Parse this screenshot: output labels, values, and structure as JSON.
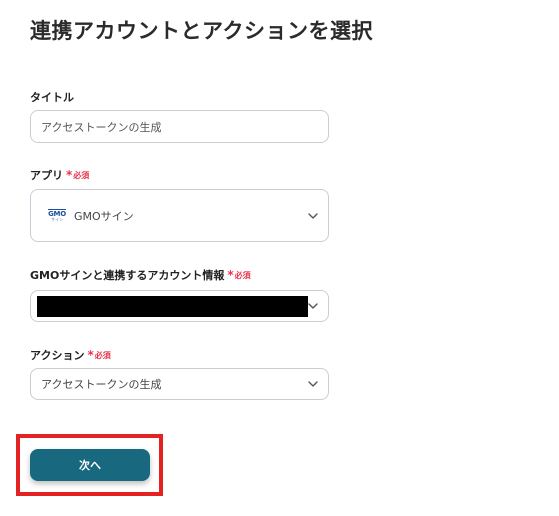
{
  "page": {
    "title": "連携アカウントとアクションを選択"
  },
  "form": {
    "title_field": {
      "label": "タイトル",
      "value": "アクセストークンの生成"
    },
    "app_field": {
      "label": "アプリ",
      "required_mark": "*",
      "required_text": "必須",
      "selected_app": "GMOサイン",
      "app_icon": "gmo-sign-logo",
      "logo_text": "GMO",
      "logo_sub": "サイン"
    },
    "account_field": {
      "label": "GMOサインと連携するアカウント情報",
      "required_mark": "*",
      "required_text": "必須",
      "selected_value": "[redacted]"
    },
    "action_field": {
      "label": "アクション",
      "required_mark": "*",
      "required_text": "必須",
      "selected_value": "アクセストークンの生成"
    }
  },
  "footer": {
    "next_label": "次へ"
  },
  "colors": {
    "primary": "#18687f",
    "required": "#e8344e",
    "highlight": "#e52222",
    "border": "#c9ced6"
  }
}
